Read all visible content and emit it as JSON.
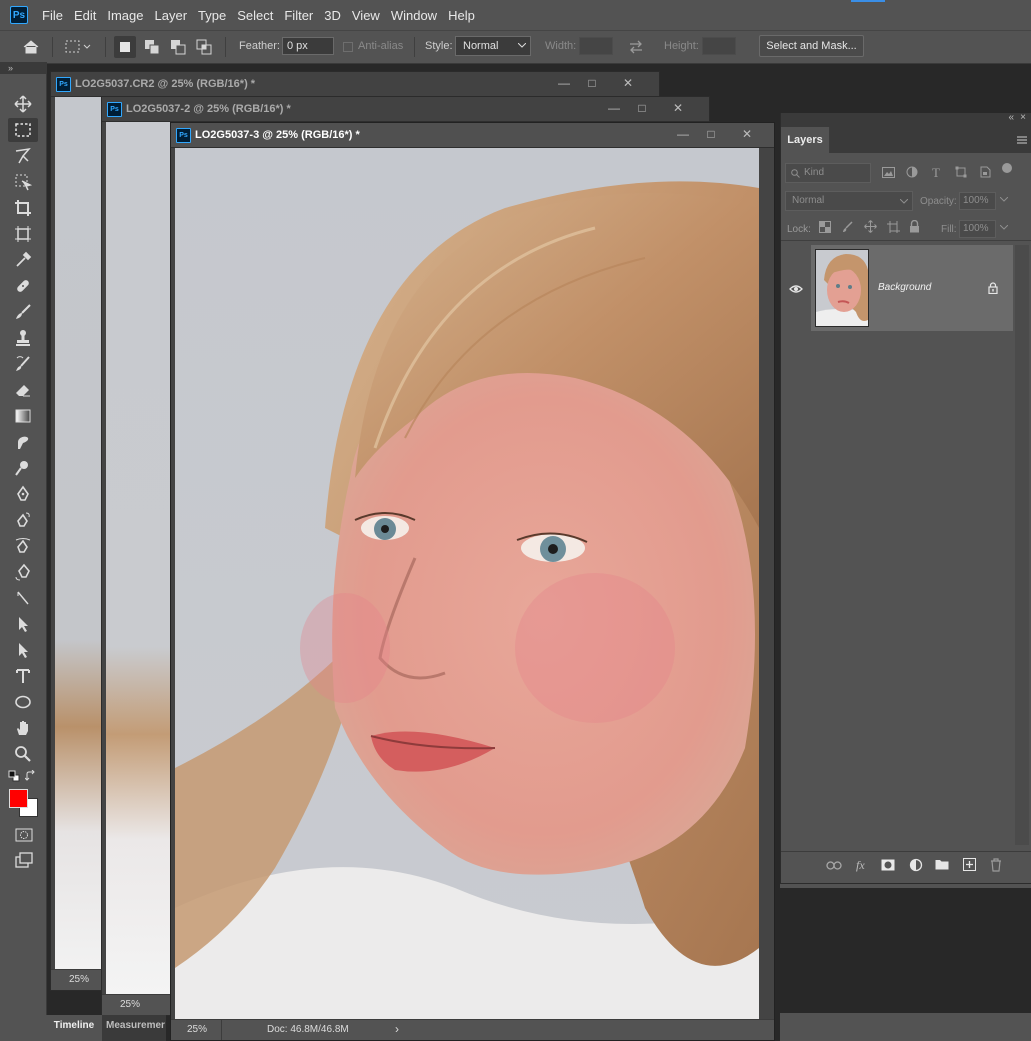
{
  "app": {
    "logo": "Ps"
  },
  "menu": {
    "items": [
      "File",
      "Edit",
      "Image",
      "Layer",
      "Type",
      "Select",
      "Filter",
      "3D",
      "View",
      "Window",
      "Help"
    ]
  },
  "options": {
    "feather_label": "Feather:",
    "feather_value": "0 px",
    "antialias_label": "Anti-alias",
    "style_label": "Style:",
    "style_value": "Normal",
    "width_label": "Width:",
    "height_label": "Height:",
    "select_mask_label": "Select and Mask..."
  },
  "documents": [
    {
      "title": "LO2G5037.CR2 @ 25% (RGB/16*) *",
      "zoom": "25%"
    },
    {
      "title": "LO2G5037-2 @ 25% (RGB/16*) *",
      "zoom": "25%"
    },
    {
      "title": "LO2G5037-3 @ 25% (RGB/16*) *",
      "zoom": "25%",
      "doc_info": "Doc: 46.8M/46.8M"
    }
  ],
  "window_buttons": {
    "minimize": "—",
    "maximize": "□",
    "close": "✕"
  },
  "layers_panel": {
    "tab": "Layers",
    "kind_placeholder": "Kind",
    "blend_mode": "Normal",
    "opacity_label": "Opacity:",
    "opacity_value": "100%",
    "lock_label": "Lock:",
    "fill_label": "Fill:",
    "fill_value": "100%",
    "layer_name": "Background"
  },
  "bottom_tabs": {
    "timeline": "Timeline",
    "measurement": "Measuremer"
  },
  "colors": {
    "foreground": "#ff0000",
    "background": "#ffffff",
    "accent": "#31a8ff"
  },
  "tools": [
    "move-icon",
    "marquee-icon",
    "lasso-icon",
    "object-select-icon",
    "crop-icon",
    "frame-icon",
    "eyedropper-icon",
    "healing-icon",
    "brush-icon",
    "stamp-icon",
    "history-brush-icon",
    "eraser-icon",
    "gradient-icon",
    "smudge-icon",
    "dodge-icon",
    "pen-icon",
    "freeform-pen-icon",
    "curvature-pen-icon",
    "anchor-pen-icon",
    "path-select-icon",
    "direct-select-icon",
    "arrow-icon",
    "type-icon",
    "ellipse-icon",
    "hand-icon",
    "zoom-icon"
  ]
}
